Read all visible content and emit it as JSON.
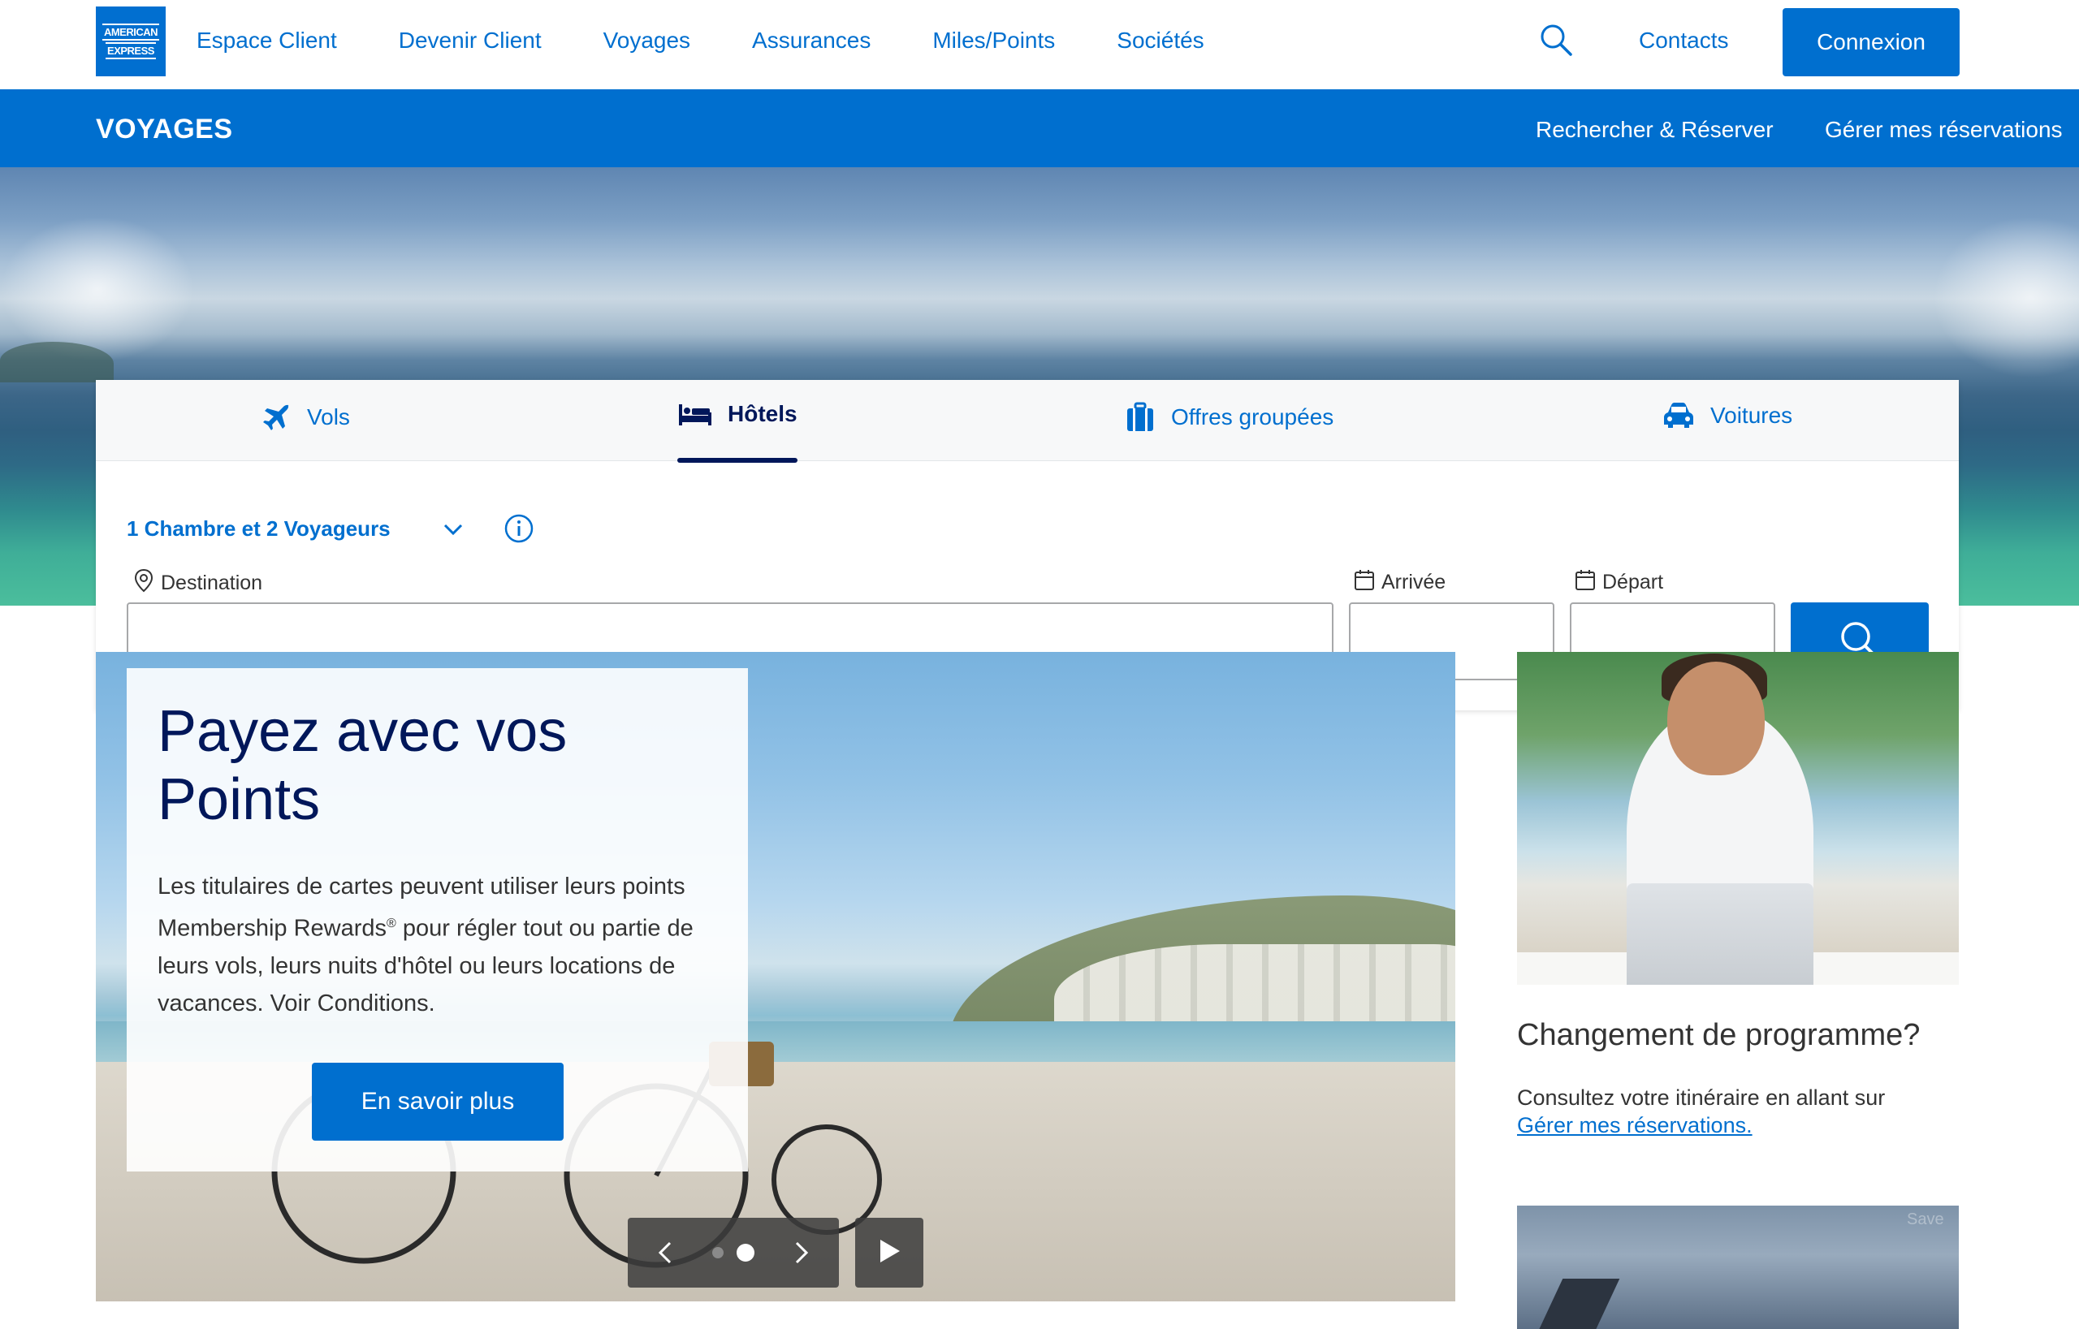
{
  "brand": {
    "logo_line1": "AMERICAN",
    "logo_line2": "EXPRESS",
    "color": "#006fcf"
  },
  "topnav": {
    "links": [
      "Espace Client",
      "Devenir Client",
      "Voyages",
      "Assurances",
      "Miles/Points",
      "Sociétés"
    ],
    "search_icon": "search-icon",
    "contacts": "Contacts",
    "login": "Connexion"
  },
  "bluebar": {
    "title": "VOYAGES",
    "links": [
      "Rechercher & Réserver",
      "Gérer mes réservations"
    ]
  },
  "search": {
    "tabs": [
      {
        "label": "Vols",
        "icon": "plane-icon"
      },
      {
        "label": "Hôtels",
        "icon": "bed-icon",
        "active": true
      },
      {
        "label": "Offres groupées",
        "icon": "luggage-icon"
      },
      {
        "label": "Voitures",
        "icon": "car-icon"
      }
    ],
    "occupancy": "1 Chambre et 2 Voyageurs",
    "destination_label": "Destination",
    "destination_value": "",
    "arrival_label": "Arrivée",
    "arrival_value": "",
    "departure_label": "Départ",
    "departure_value": ""
  },
  "promo": {
    "title": "Payez avec vos Points",
    "text_before_mark": "Les titulaires de cartes peuvent utiliser leurs points Membership Rewards",
    "mark": "®",
    "text_after_mark": " pour régler tout ou partie de leurs vols, leurs nuits d'hôtel ou leurs locations de vacances. Voir Conditions.",
    "cta": "En savoir plus",
    "slides_total": 2,
    "active_slide": 2
  },
  "side": {
    "title": "Changement de programme?",
    "text": "Consultez votre itinéraire en allant sur",
    "link": "Gérer mes réservations.",
    "save_watermark": "Save"
  }
}
